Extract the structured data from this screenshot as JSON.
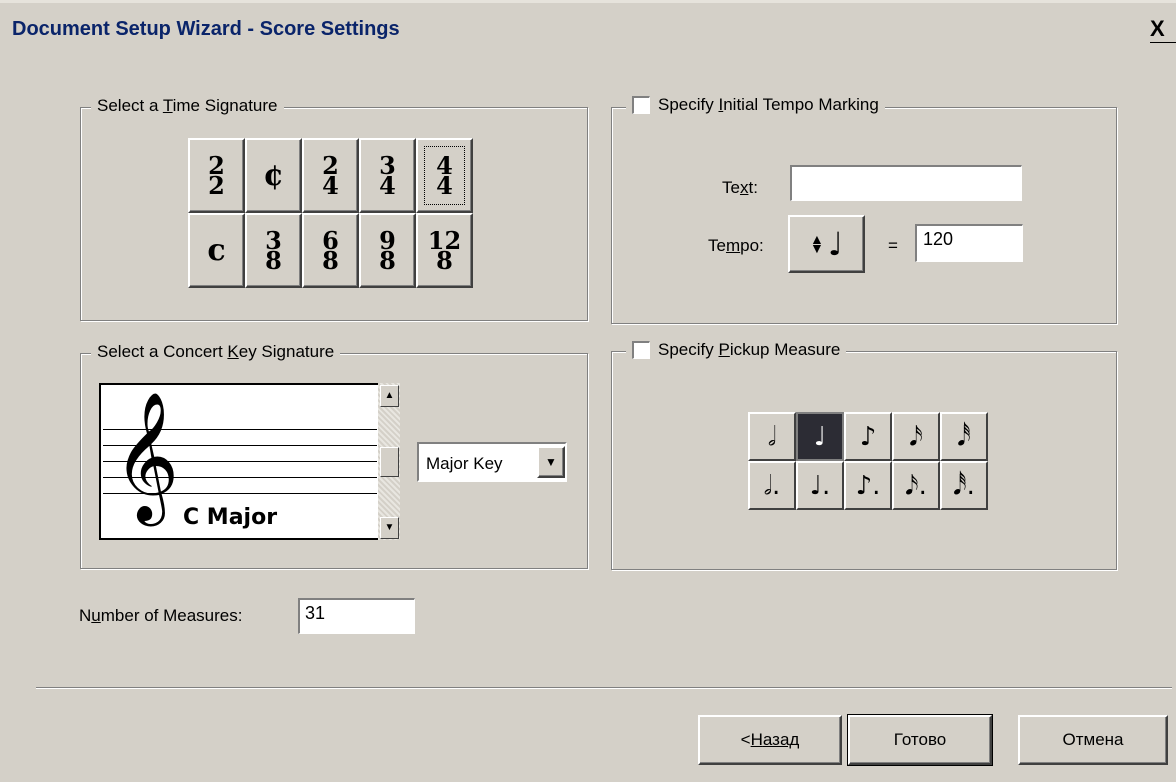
{
  "window": {
    "title": "Document Setup Wizard - Score Settings",
    "close_glyph": "X"
  },
  "time_signature": {
    "legend_pre": "Select a ",
    "legend_key": "T",
    "legend_post": "ime Signature",
    "row1": [
      {
        "num": "2",
        "den": "2"
      },
      {
        "symbol": "¢"
      },
      {
        "num": "2",
        "den": "4"
      },
      {
        "num": "3",
        "den": "4"
      },
      {
        "num": "4",
        "den": "4",
        "selected": true
      }
    ],
    "row2": [
      {
        "symbol": "c"
      },
      {
        "num": "3",
        "den": "8"
      },
      {
        "num": "6",
        "den": "8"
      },
      {
        "num": "9",
        "den": "8"
      },
      {
        "num": "12",
        "den": "8"
      }
    ]
  },
  "tempo": {
    "checkbox_pre": "Specify ",
    "checkbox_key": "I",
    "checkbox_post": "nitial Tempo Marking",
    "text_label_pre": "Te",
    "text_label_key": "x",
    "text_label_post": "t:",
    "text_value": "",
    "tempo_label_pre": "Te",
    "tempo_label_key": "m",
    "tempo_label_post": "po:",
    "note_button_glyph": "♩",
    "equals": "=",
    "tempo_value": "120"
  },
  "key_signature": {
    "legend_pre": "Select a Concert ",
    "legend_key": "K",
    "legend_post": "ey Signature",
    "current_key": "C Major",
    "clef_glyph": "𝄞",
    "mode_select": "Major Key",
    "mode_options": [
      "Major Key"
    ]
  },
  "pickup": {
    "checkbox_pre": "Specify ",
    "checkbox_key": "P",
    "checkbox_post": "ickup Measure",
    "row1": [
      "𝅗𝅥",
      "♩",
      "♪",
      "𝅘𝅥𝅯",
      "𝅘𝅥𝅰"
    ],
    "row2": [
      "𝅗𝅥.",
      "♩.",
      "♪.",
      "𝅘𝅥𝅯.",
      "𝅘𝅥𝅰."
    ],
    "active_index": 1
  },
  "measures": {
    "label_pre": "N",
    "label_key": "u",
    "label_post": "mber of Measures:",
    "value": "31"
  },
  "buttons": {
    "back_pre": "< ",
    "back_key": "Н",
    "back_post": "азад",
    "finish": "Готово",
    "cancel": "Отмена"
  }
}
